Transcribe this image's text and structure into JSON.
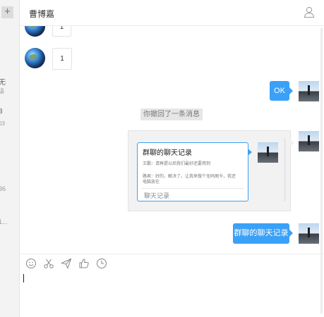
{
  "sidebar": {
    "plus_label": "+",
    "fragments": [
      "无",
      "语",
      "3",
      "03",
      "36",
      "1..."
    ]
  },
  "header": {
    "title": "曹博嘉"
  },
  "messages": {
    "top_partial_text": "1",
    "left_text": "1",
    "ok_text": "OK",
    "system_notice": "你撤回了一条消息",
    "forward_card": {
      "title": "群聊的聊天记录",
      "line1": "王鹏：请再提以后我们最好还要用到",
      "line2": "路君：好的，解决了，让我来做个无码图卡，我还",
      "line3": "电脑放在",
      "footer": "聊天记录"
    },
    "last_text": "群聊的聊天记录"
  },
  "toolbar": {
    "icons": [
      "emoji-icon",
      "scissors-icon",
      "send-icon",
      "thumbs-up-icon",
      "clock-icon"
    ]
  },
  "colors": {
    "accent": "#3aa1f7",
    "notice_bg": "#e6e6e6"
  }
}
